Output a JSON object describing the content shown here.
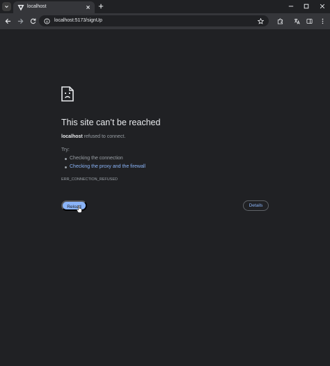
{
  "browser": {
    "tab": {
      "title": "localhost",
      "favicon": "vite-favicon-icon"
    },
    "address_bar": {
      "url": "localhost:5173/signUp"
    },
    "colors": {
      "frame": "#202124",
      "toolbar": "#35363a",
      "accent": "#8ab4f8"
    }
  },
  "error_page": {
    "icon": "sad-page-icon",
    "headline": "This site can’t be reached",
    "host": "localhost",
    "message": " refused to connect.",
    "try_label": "Try:",
    "suggestions": [
      {
        "text": "Checking the connection",
        "is_link": false
      },
      {
        "text": "Checking the proxy and the firewall",
        "is_link": true
      }
    ],
    "error_code": "ERR_CONNECTION_REFUSED",
    "reload_label": "Reload",
    "details_label": "Details"
  }
}
